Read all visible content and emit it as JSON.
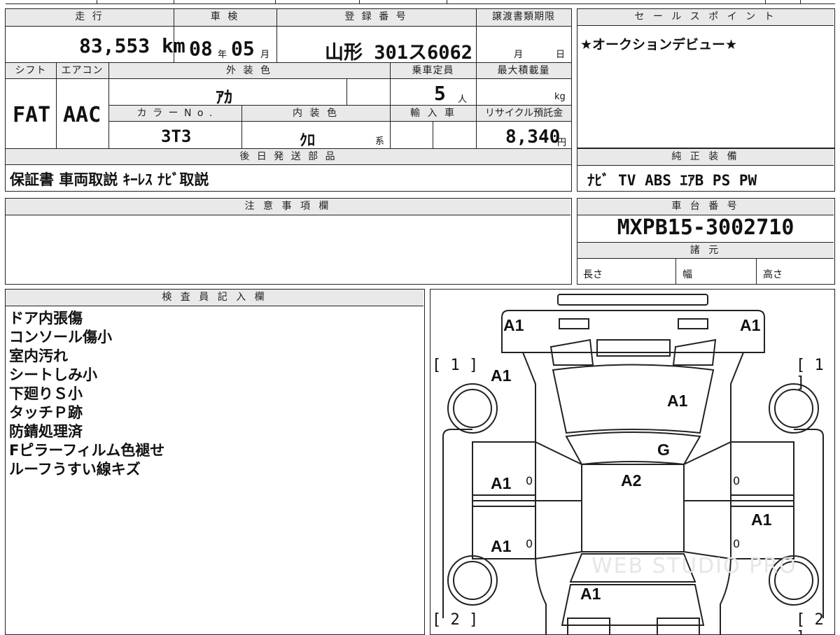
{
  "top": {
    "mileage_label": "走 行",
    "mileage_value": "83,553 km",
    "shaken_label": "車 検",
    "shaken_year": "08",
    "shaken_year_unit": "年",
    "shaken_month": "05",
    "shaken_month_unit": "月",
    "reg_label": "登 録 番 号",
    "reg_value": "山形 301ス6062",
    "transfer_label": "譲渡書類期限",
    "transfer_month_unit": "月",
    "transfer_day_unit": "日"
  },
  "row2": {
    "shift_label": "シフト",
    "shift_value": "FAT",
    "ac_label": "エアコン",
    "ac_value": "AAC",
    "exterior_label": "外 装 色",
    "exterior_value": "ｱｶ",
    "capacity_label": "乗車定員",
    "capacity_value": "5",
    "capacity_unit": "人",
    "maxload_label": "最大積載量",
    "maxload_unit": "kg",
    "color_no_label": "カ ラ ー N o .",
    "color_no_value": "3T3",
    "interior_label": "内 装 色",
    "interior_value": "ｸﾛ",
    "interior_suffix": "系",
    "import_label": "輸 入 車",
    "recycle_label": "リサイクル預託金",
    "recycle_value": "8,340",
    "recycle_unit": "円"
  },
  "parts": {
    "label": "後 日 発 送 部 品",
    "value": "保証書 車両取説 ｷｰﾚｽ ﾅﾋﾞ取説"
  },
  "sales": {
    "label": "セ ー ル ス ポ イ ン ト",
    "value": "★オークションデビュー★"
  },
  "equipment": {
    "label": "純 正 装 備",
    "value": "ﾅﾋﾞ TV ABS ｴｱB PS PW"
  },
  "caution": {
    "label": "注 意 事 項 欄"
  },
  "chassis": {
    "label": "車 台 番 号",
    "value": "MXPB15-3002710",
    "specs_label": "諸 元",
    "length_label": "長さ",
    "width_label": "幅",
    "height_label": "高さ"
  },
  "inspector": {
    "label": "検 査 員 記 入 欄",
    "notes": [
      "ドア内張傷",
      "コンソール傷小",
      "室内汚れ",
      "シートしみ小",
      "下廻りＳ小",
      "タッチＰ跡",
      "防錆処理済",
      "Fピラーフィルム色褪せ",
      "ルーフうすい線キズ"
    ]
  },
  "diagram": {
    "marks": {
      "front_left": "A1",
      "front_right": "A1",
      "fender_left": "A1",
      "bonnet": "A1",
      "windshield": "G",
      "roof": "A2",
      "door_fl": "A1",
      "door_rl": "A1",
      "door_rr": "A1",
      "trunk": "A1",
      "zero_fl": "0",
      "zero_rl": "0",
      "zero_fr": "0",
      "zero_rr": "0"
    },
    "tire_front_left": "[ 1 ]",
    "tire_front_right": "[ 1 ]",
    "tire_rear_left": "[ 2 ]",
    "tire_rear_right": "[ 2 ]",
    "watermark": "WEB STUDIO PRO"
  }
}
